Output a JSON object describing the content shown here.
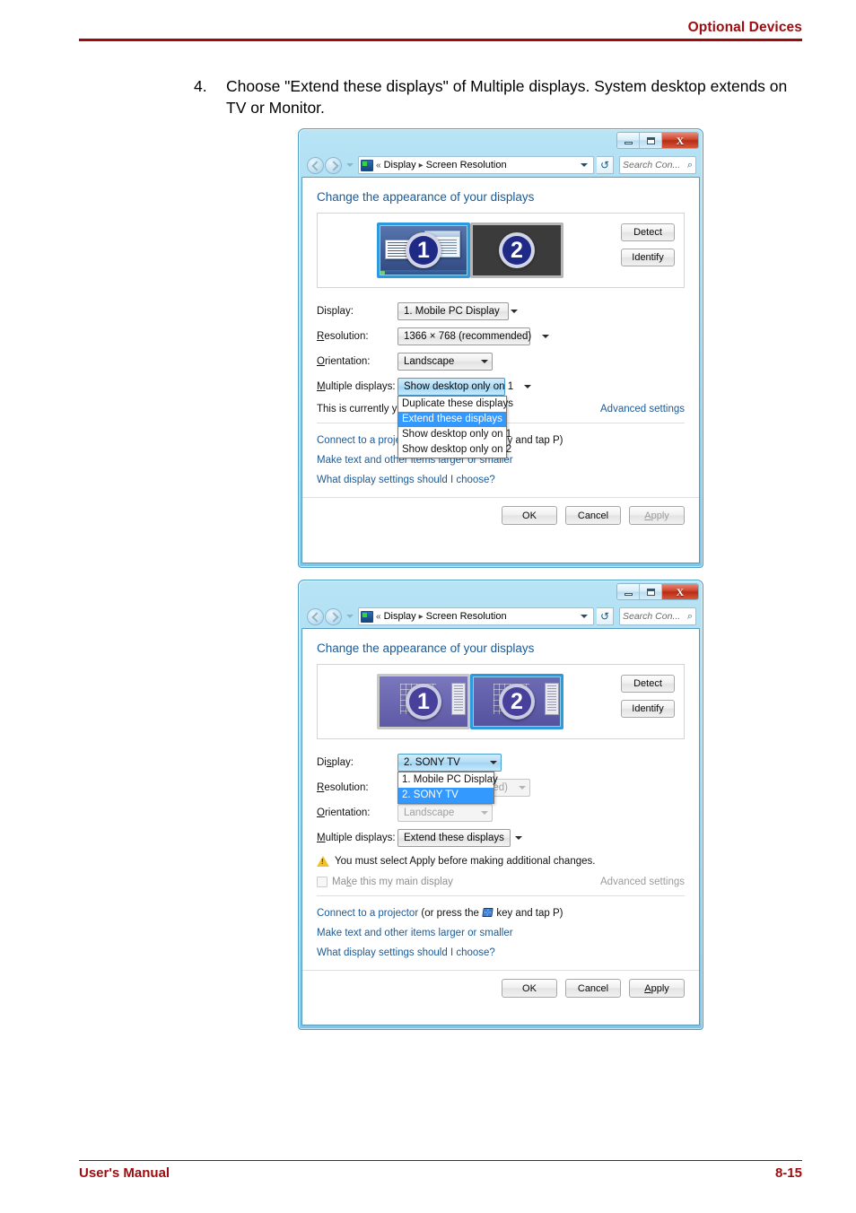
{
  "page": {
    "header_title": "Optional Devices",
    "footer_left": "User's Manual",
    "footer_right": "8-15",
    "step_number": "4.",
    "step_text": "Choose \"Extend these displays\" of Multiple displays. System desktop extends on TV or Monitor."
  },
  "window": {
    "nav": {
      "breadcrumb_chevrons": "«",
      "crumb1": "Display",
      "crumb_sep": "▸",
      "crumb2": "Screen Resolution",
      "search_placeholder": "Search Con...",
      "search_icon": "⌕",
      "refresh_icon": "↺"
    },
    "page_title": "Change the appearance of your displays",
    "detect_label": "Detect",
    "identify_label": "Identify",
    "labels": {
      "display": "Display:",
      "resolution": "Resolution:",
      "orientation": "Orientation:",
      "multiple_displays": "Multiple displays:"
    },
    "links": {
      "advanced_settings": "Advanced settings",
      "projector_prefix": "Connect to a projector",
      "projector_mid": "(or press the",
      "projector_suffix": "key and tap P)",
      "text_size": "Make text and other items larger or smaller",
      "what_settings": "What display settings should I choose?"
    },
    "buttons": {
      "ok": "OK",
      "cancel": "Cancel",
      "apply": "Apply"
    }
  },
  "dialog1": {
    "display_value": "1. Mobile PC Display",
    "resolution_value": "1366 × 768 (recommended)",
    "orientation_value": "Landscape",
    "multiple_value": "Show desktop only on 1",
    "status_text": "This is currently your main display.",
    "multiple_options": [
      {
        "label": "Duplicate these displays",
        "highlighted": false
      },
      {
        "label": "Extend these displays",
        "highlighted": true
      },
      {
        "label": "Show desktop only on 1",
        "highlighted": false
      },
      {
        "label": "Show desktop only on 2",
        "highlighted": false
      }
    ],
    "monitors": [
      {
        "number": "1",
        "selected": true,
        "style": "desktop"
      },
      {
        "number": "2",
        "selected": false,
        "style": "blank"
      }
    ]
  },
  "dialog2": {
    "display_value": "2. SONY TV",
    "resolution_value": "ded)",
    "orientation_value": "Landscape",
    "multiple_value": "Extend these displays",
    "warning_text": "You must select Apply before making additional changes.",
    "main_display_checkbox": "Make this my main display",
    "display_options": [
      {
        "label": "1. Mobile PC Display",
        "highlighted": false
      },
      {
        "label": "2. SONY TV",
        "highlighted": true
      }
    ],
    "monitors": [
      {
        "number": "1",
        "selected": false,
        "style": "purple"
      },
      {
        "number": "2",
        "selected": true,
        "style": "purple"
      }
    ]
  },
  "colors": {
    "brand_red": "#9e0b0f",
    "link_blue": "#1a5a96",
    "highlight_blue": "#3399ff",
    "title_bar": "#9fd9f0"
  }
}
